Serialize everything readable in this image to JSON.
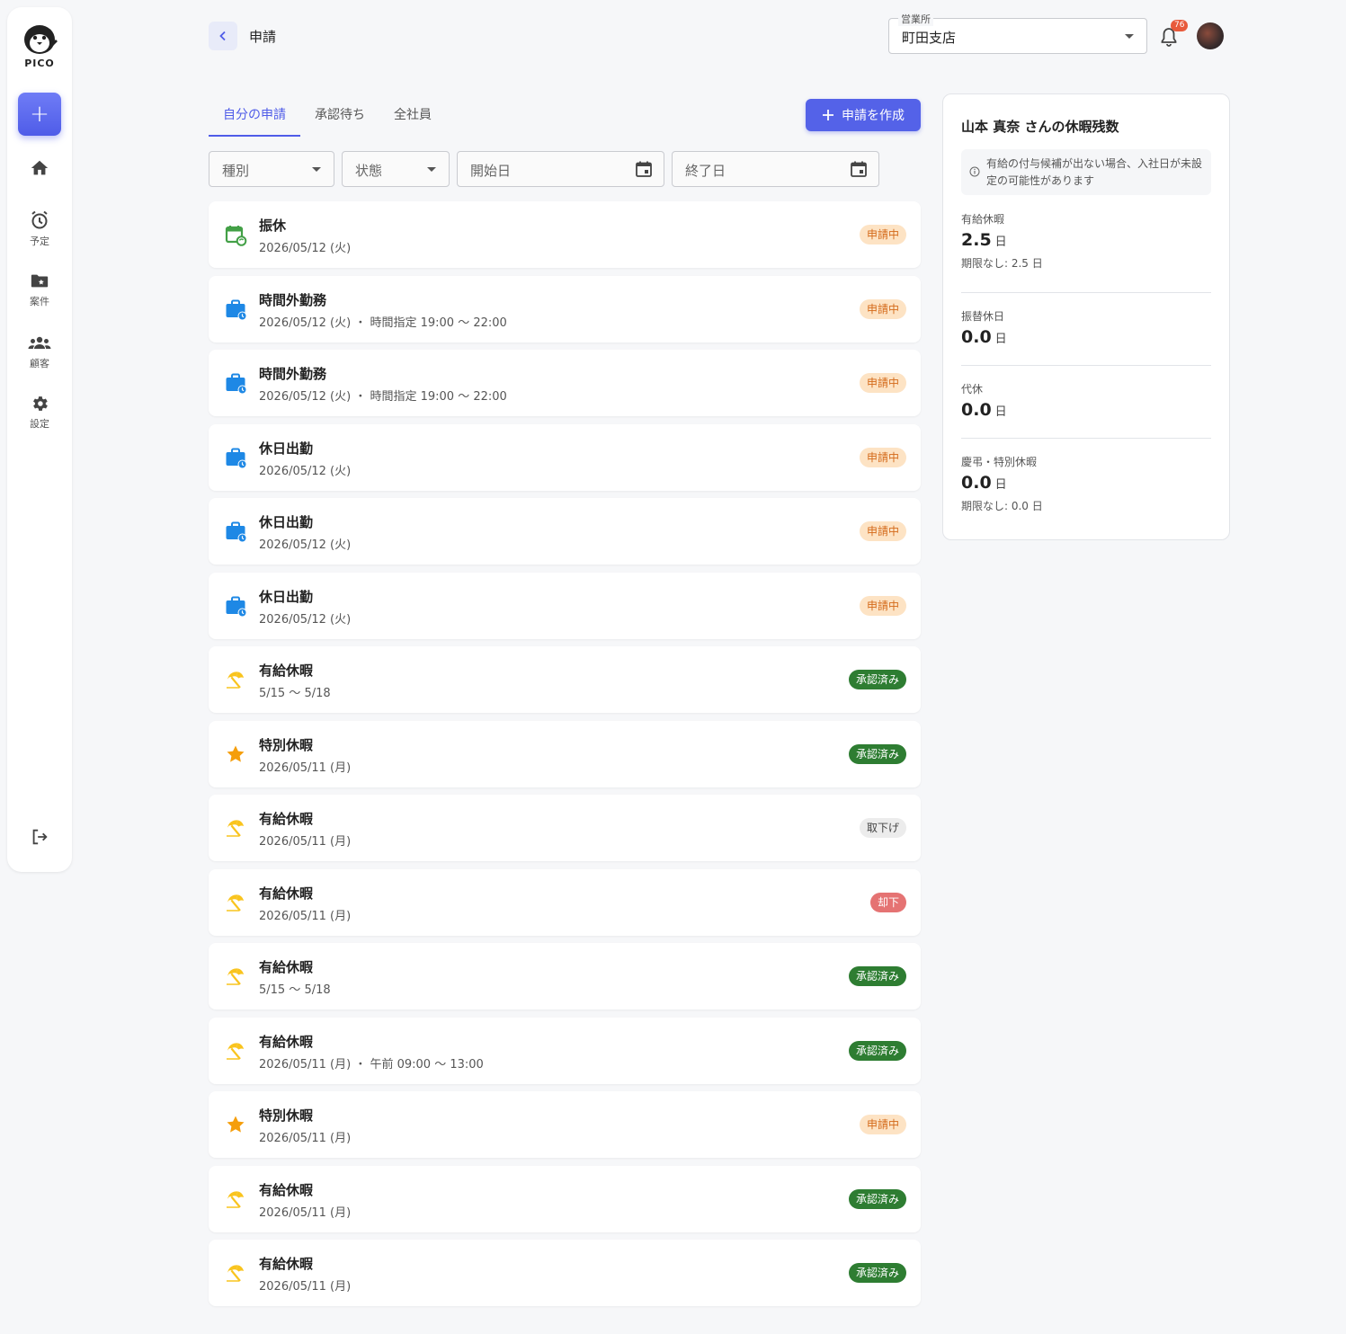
{
  "sidebar": {
    "brand": "PICO",
    "add_label": "+",
    "items": [
      {
        "label": ""
      },
      {
        "label": "予定"
      },
      {
        "label": "案件"
      },
      {
        "label": "顧客"
      },
      {
        "label": "設定"
      }
    ]
  },
  "header": {
    "title": "申請",
    "office_label": "営業所",
    "office_value": "町田支店",
    "notification_count": "76"
  },
  "tabs": [
    {
      "label": "自分の申請"
    },
    {
      "label": "承認待ち"
    },
    {
      "label": "全社員"
    }
  ],
  "create_button": "申請を作成",
  "filters": {
    "type": "種別",
    "state": "状態",
    "start": "開始日",
    "end": "終了日"
  },
  "requests": [
    {
      "icon": "calendar-sync-icon",
      "title": "振休",
      "sub": "2026/05/12 (火)",
      "status": "申請中",
      "kind": "pending"
    },
    {
      "icon": "briefcase-clock-icon",
      "title": "時間外勤務",
      "sub": "2026/05/12 (火) ・ 時間指定 19:00 〜 22:00",
      "status": "申請中",
      "kind": "pending"
    },
    {
      "icon": "briefcase-clock-icon",
      "title": "時間外勤務",
      "sub": "2026/05/12 (火) ・ 時間指定 19:00 〜 22:00",
      "status": "申請中",
      "kind": "pending"
    },
    {
      "icon": "briefcase-clock-icon",
      "title": "休日出勤",
      "sub": "2026/05/12 (火)",
      "status": "申請中",
      "kind": "pending"
    },
    {
      "icon": "briefcase-clock-icon",
      "title": "休日出勤",
      "sub": "2026/05/12 (火)",
      "status": "申請中",
      "kind": "pending"
    },
    {
      "icon": "briefcase-clock-icon",
      "title": "休日出勤",
      "sub": "2026/05/12 (火)",
      "status": "申請中",
      "kind": "pending"
    },
    {
      "icon": "beach-umbrella-icon",
      "title": "有給休暇",
      "sub": "5/15 〜 5/18",
      "status": "承認済み",
      "kind": "approved"
    },
    {
      "icon": "star-icon",
      "title": "特別休暇",
      "sub": "2026/05/11 (月)",
      "status": "承認済み",
      "kind": "approved"
    },
    {
      "icon": "beach-umbrella-icon",
      "title": "有給休暇",
      "sub": "2026/05/11 (月)",
      "status": "取下げ",
      "kind": "withdrawn"
    },
    {
      "icon": "beach-umbrella-icon",
      "title": "有給休暇",
      "sub": "2026/05/11 (月)",
      "status": "却下",
      "kind": "rejected"
    },
    {
      "icon": "beach-umbrella-icon",
      "title": "有給休暇",
      "sub": "5/15 〜 5/18",
      "status": "承認済み",
      "kind": "approved"
    },
    {
      "icon": "beach-umbrella-icon",
      "title": "有給休暇",
      "sub": "2026/05/11 (月) ・ 午前 09:00 〜 13:00",
      "status": "承認済み",
      "kind": "approved"
    },
    {
      "icon": "star-icon",
      "title": "特別休暇",
      "sub": "2026/05/11 (月)",
      "status": "申請中",
      "kind": "pending"
    },
    {
      "icon": "beach-umbrella-icon",
      "title": "有給休暇",
      "sub": "2026/05/11 (月)",
      "status": "承認済み",
      "kind": "approved"
    },
    {
      "icon": "beach-umbrella-icon",
      "title": "有給休暇",
      "sub": "2026/05/11 (月)",
      "status": "承認済み",
      "kind": "approved"
    }
  ],
  "panel": {
    "title": "山本 真奈 さんの休暇残数",
    "notice": "有給の付与候補が出ない場合、入社日が未設定の可能性があります",
    "balances": [
      {
        "label": "有給休暇",
        "value": "2.5",
        "unit": "日",
        "note": "期限なし: 2.5 日"
      },
      {
        "label": "振替休日",
        "value": "0.0",
        "unit": "日",
        "note": ""
      },
      {
        "label": "代休",
        "value": "0.0",
        "unit": "日",
        "note": ""
      },
      {
        "label": "慶弔・特別休暇",
        "value": "0.0",
        "unit": "日",
        "note": "期限なし: 0.0 日"
      }
    ]
  },
  "colors": {
    "accent": "#5462e8",
    "pending_bg": "#fde3c4",
    "approved_bg": "#2e7d32",
    "rejected_bg": "#e57373",
    "withdrawn_bg": "#ececec"
  }
}
